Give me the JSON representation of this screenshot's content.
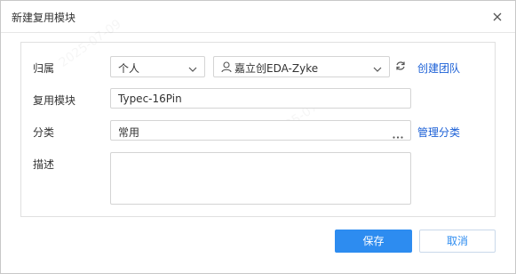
{
  "dialog": {
    "title": "新建复用模块",
    "close_icon": "close-icon"
  },
  "form": {
    "owner": {
      "label": "归属",
      "type_value": "个人",
      "team_value": "嘉立创EDA-Zyke",
      "refresh_icon": "refresh-icon",
      "create_team_link": "创建团队"
    },
    "module": {
      "label": "复用模块",
      "value": "Typec-16Pin"
    },
    "category": {
      "label": "分类",
      "value": "常用",
      "more_icon": "ellipsis-icon",
      "manage_link": "管理分类"
    },
    "description": {
      "label": "描述",
      "value": ""
    }
  },
  "footer": {
    "save_label": "保存",
    "cancel_label": "取消"
  },
  "colors": {
    "accent": "#2d8cf0",
    "link": "#1a5fd6",
    "border": "#d4d4d4"
  }
}
